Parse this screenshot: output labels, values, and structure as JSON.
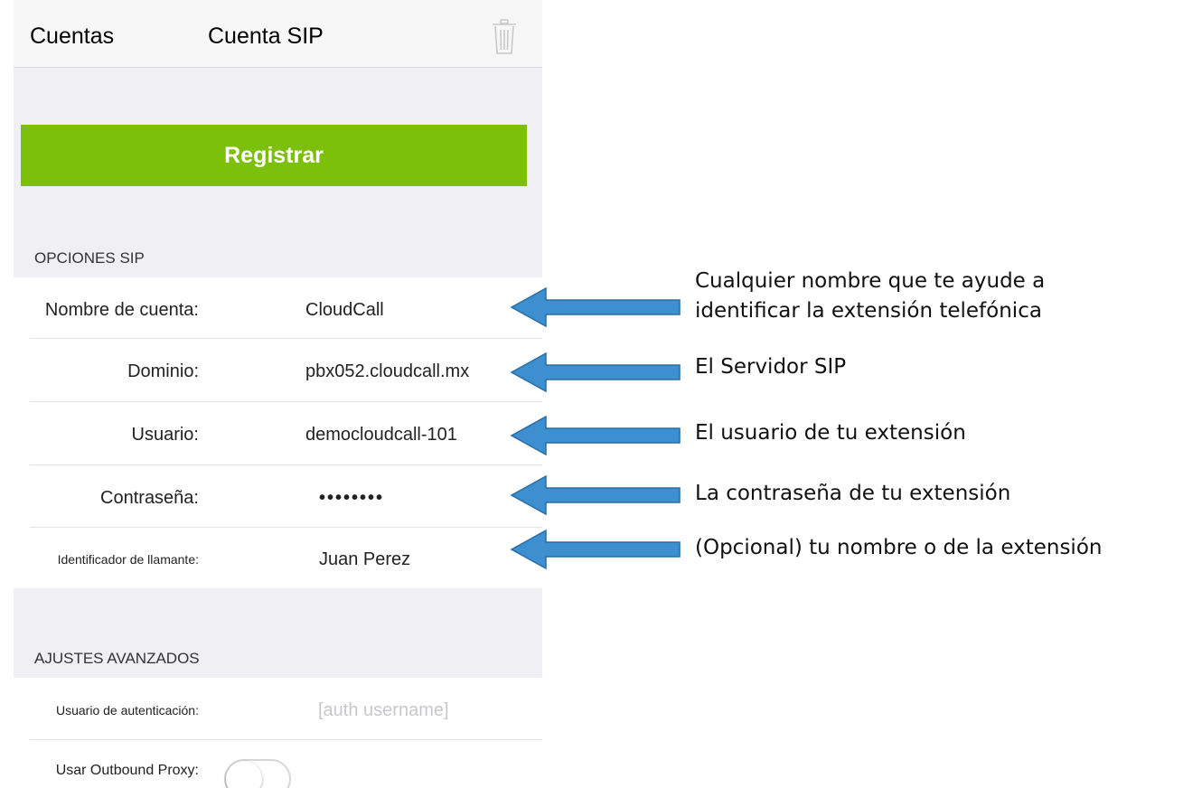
{
  "navbar": {
    "back_label": "Cuentas",
    "title": "Cuenta SIP",
    "trash_icon": "trash-icon"
  },
  "register_button": {
    "label": "Registrar",
    "color": "#7cc00c"
  },
  "sip_options": {
    "header": "OPCIONES SIP",
    "rows": [
      {
        "label": "Nombre de cuenta:",
        "value": "CloudCall"
      },
      {
        "label": "Dominio:",
        "value": "pbx052.cloudcall.mx"
      },
      {
        "label": "Usuario:",
        "value": "democloudcall-101"
      },
      {
        "label": "Contraseña:",
        "value": "••••••••"
      },
      {
        "label": "Identificador de llamante:",
        "value": "Juan Perez"
      }
    ]
  },
  "advanced": {
    "header": "AJUSTES AVANZADOS",
    "auth_user_label": "Usuario de autenticación:",
    "auth_user_placeholder": "[auth username]",
    "outbound_proxy_label": "Usar Outbound Proxy:",
    "outbound_proxy_on": false
  },
  "annotations": [
    {
      "line1": "Cualquier nombre que te ayude a",
      "line2": "identificar la extensión telefónica"
    },
    {
      "line1": "El Servidor SIP"
    },
    {
      "line1": "El usuario de tu extensión"
    },
    {
      "line1": "La contraseña de tu extensión"
    },
    {
      "line1": "(Opcional) tu nombre o de la extensión"
    }
  ],
  "arrow_color": "#3d8fd0"
}
